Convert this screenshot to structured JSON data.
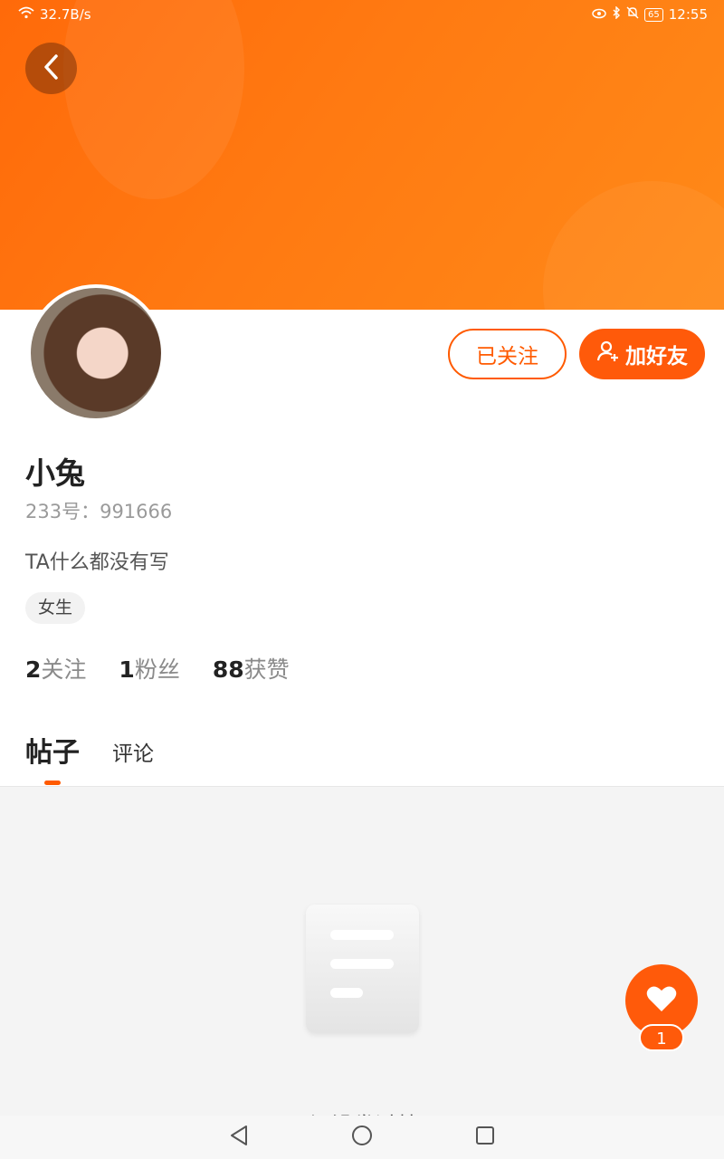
{
  "status_bar": {
    "net_speed": "32.7B/s",
    "battery": "65",
    "time": "12:55"
  },
  "profile": {
    "name": "小兔",
    "id_text": "233号：991666",
    "bio": "TA什么都没有写",
    "tag": "女生"
  },
  "actions": {
    "following_label": "已关注",
    "add_friend_label": "加好友"
  },
  "stats": [
    {
      "num": "2",
      "label": "关注"
    },
    {
      "num": "1",
      "label": "粉丝"
    },
    {
      "num": "88",
      "label": "获赞"
    }
  ],
  "tabs": [
    {
      "label": "帖子",
      "active": true
    },
    {
      "label": "评论",
      "active": false
    }
  ],
  "empty_state": {
    "text": "TA还没发过帖子"
  },
  "like_fab": {
    "count": "1"
  },
  "colors": {
    "accent": "#ff5a00",
    "hero": "#ff7a12"
  }
}
